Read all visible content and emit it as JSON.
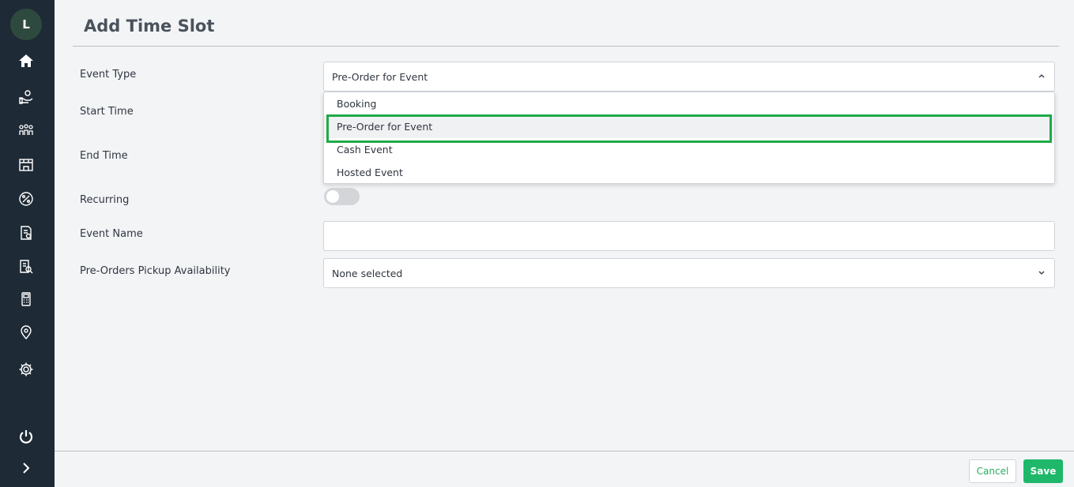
{
  "user": {
    "initial": "L"
  },
  "page": {
    "title": "Add Time Slot"
  },
  "form": {
    "event_type": {
      "label": "Event Type",
      "value": "Pre-Order for Event",
      "options": [
        "Booking",
        "Pre-Order for Event",
        "Cash Event",
        "Hosted Event"
      ],
      "selected_index": 1,
      "open": true
    },
    "start_time": {
      "label": "Start Time"
    },
    "end_time": {
      "label": "End Time"
    },
    "recurring": {
      "label": "Recurring",
      "on": false
    },
    "event_name": {
      "label": "Event Name",
      "value": ""
    },
    "pickup": {
      "label": "Pre-Orders Pickup Availability",
      "value": "None selected"
    }
  },
  "footer": {
    "cancel_label": "Cancel",
    "save_label": "Save"
  },
  "colors": {
    "sidebar": "#1e2a36",
    "accent": "#1fb86a",
    "highlight": "#1faa48"
  },
  "nav_icons": [
    "home-icon",
    "hand-coins-icon",
    "people-group-icon",
    "store-icon",
    "percent-icon",
    "report-icon",
    "report-search-icon",
    "pos-terminal-icon",
    "location-pin-icon",
    "gear-icon",
    "power-icon",
    "chevron-right-icon"
  ]
}
